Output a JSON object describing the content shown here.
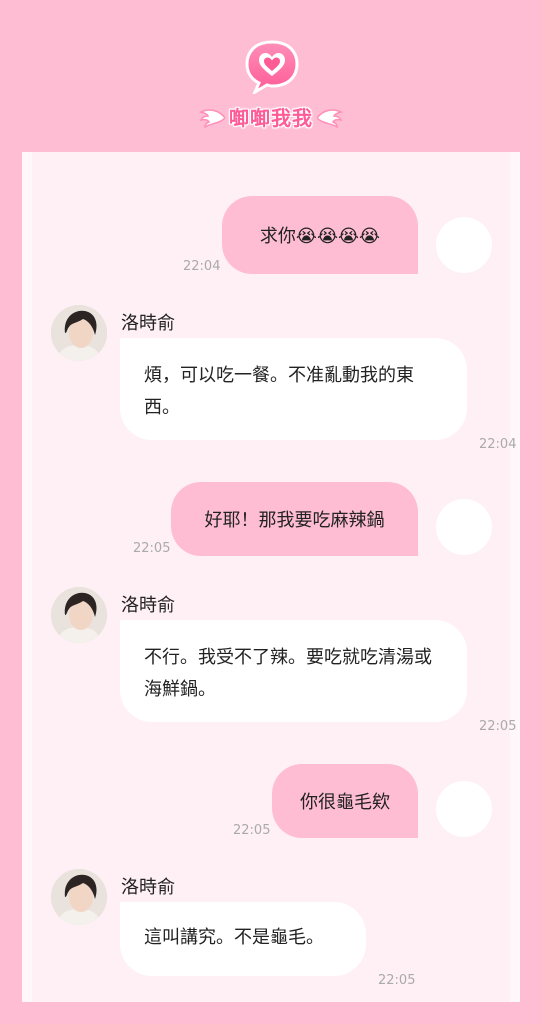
{
  "header": {
    "logo_text": "啣啣我我",
    "logo_icon": "chat-heart-icon",
    "accent_color": "#ff5b97"
  },
  "messages": [
    {
      "type": "sent",
      "text": "求你😭😭😭😭",
      "time": "22:04"
    },
    {
      "type": "received",
      "name": "洛時俞",
      "text": "煩，可以吃一餐。不准亂動我的東西。",
      "time": "22:04"
    },
    {
      "type": "sent",
      "text": "好耶！那我要吃麻辣鍋",
      "time": "22:05"
    },
    {
      "type": "received",
      "name": "洛時俞",
      "text": "不行。我受不了辣。要吃就吃清湯或海鮮鍋。",
      "time": "22:05"
    },
    {
      "type": "sent",
      "text": "你很龜毛欸",
      "time": "22:05"
    },
    {
      "type": "received",
      "name": "洛時俞",
      "text": "這叫講究。不是龜毛。",
      "time": "22:05"
    }
  ],
  "colors": {
    "background": "#ffbdd4",
    "sent_bubble": "#ffbdd4",
    "received_bubble": "#ffffff",
    "panel": "#fff0f5"
  }
}
